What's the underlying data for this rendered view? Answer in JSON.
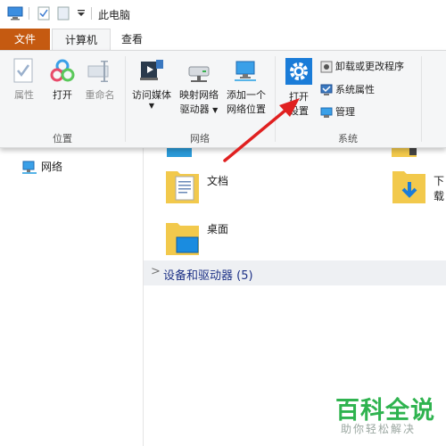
{
  "window": {
    "title": "此电脑"
  },
  "tabs": {
    "file": "文件",
    "computer": "计算机",
    "view": "查看"
  },
  "ribbon": {
    "location_group": {
      "label": "位置",
      "properties": "属性",
      "open": "打开",
      "rename": "重命名"
    },
    "network_group": {
      "label": "网络",
      "access_media": "访问媒体",
      "map_drive_line1": "映射网络",
      "map_drive_line2": "驱动器",
      "add_location_line1": "添加一个",
      "add_location_line2": "网络位置"
    },
    "system_group": {
      "label": "系统",
      "open_settings_line1": "打开",
      "open_settings_line2": "设置",
      "uninstall": "卸载或更改程序",
      "system_properties": "系统属性",
      "manage": "管理"
    }
  },
  "nav": {
    "network": "网络"
  },
  "content": {
    "documents": "文档",
    "downloads": "下载",
    "desktop": "桌面",
    "devices_section": "设备和驱动器 (5)"
  },
  "watermark": {
    "main": "百科全说",
    "sub": "助你轻松解决"
  },
  "colors": {
    "file_tab": "#c55a11",
    "highlight": "#1a7cd8",
    "arrow": "#e02020",
    "section_text": "#1e3287",
    "watermark": "#2fb34f"
  }
}
